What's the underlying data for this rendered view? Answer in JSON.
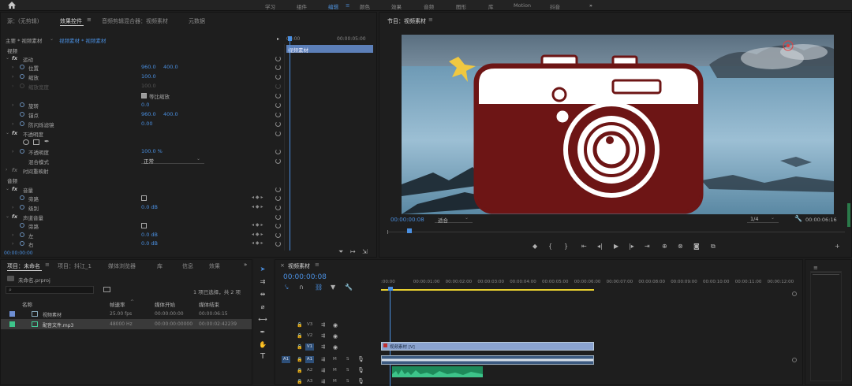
{
  "workspaces": {
    "home_icon": "home-icon",
    "items": [
      "学习",
      "组件",
      "编辑",
      "颜色",
      "效果",
      "音频",
      "图形",
      "库",
      "Motion",
      "抖音"
    ],
    "active": "编辑",
    "more": "»"
  },
  "source_panel": {
    "tabs": [
      "源：(无剪辑)",
      "效果控件",
      "音频剪辑混合器：视频素材",
      "元数据"
    ],
    "active_tab": "效果控件",
    "clip_path": "主要 * 视频素材",
    "clip_active": "视频素材 * 视频素材",
    "mini_timecode_start": "00:00",
    "mini_timecode_end": "00:00:05:00",
    "mini_clip_label": "视频素材",
    "video_header": "视频",
    "motion": {
      "name": "运动",
      "fx": "fx"
    },
    "position": {
      "label": "位置",
      "x": "960.0",
      "y": "400.0"
    },
    "scale": {
      "label": "缩放",
      "value": "100.0"
    },
    "scale_width": {
      "label": "缩放宽度",
      "value": "100.0"
    },
    "uniform_scale": {
      "label": "等比缩放",
      "checked": true
    },
    "rotation": {
      "label": "旋转",
      "value": "0.0"
    },
    "anchor": {
      "label": "锚点",
      "x": "960.0",
      "y": "400.0"
    },
    "flicker": {
      "label": "防闪烁滤镜",
      "value": "0.00"
    },
    "opacity": {
      "name": "不透明度",
      "fx": "fx"
    },
    "opacity_value": {
      "label": "不透明度",
      "value": "100.0 %"
    },
    "blend": {
      "label": "混合模式",
      "value": "正常"
    },
    "time_remap": {
      "name": "时间重映射",
      "fx": "fx"
    },
    "audio_header": "音频",
    "volume": {
      "name": "音量",
      "fx": "fx"
    },
    "bypass1": {
      "label": "旁路"
    },
    "level": {
      "label": "级别",
      "value": "0.0 dB"
    },
    "channel_volume": {
      "name": "声道音量",
      "fx": "fx"
    },
    "bypass2": {
      "label": "旁路"
    },
    "left": {
      "label": "左",
      "value": "0.0 dB"
    },
    "right": {
      "label": "右",
      "value": "0.0 dB"
    },
    "bottom_timecode": "00:00:00:00"
  },
  "program_panel": {
    "title": "节目：视频素材",
    "timecode_current": "00:00:00:08",
    "fit": "适合",
    "resolution": "1/4",
    "timecode_end": "00:00:06:16"
  },
  "project_panel": {
    "tabs": [
      "项目：未命名",
      "项目：抖江_1",
      "媒体浏览器",
      "库",
      "信息",
      "效果"
    ],
    "active_tab": "项目：未命名",
    "more": "»",
    "project_file": "未命名.prproj",
    "selection_info": "1 项已选择，共 2 项",
    "columns": {
      "name": "名称",
      "fps": "帧速率",
      "media_start": "媒体开始",
      "media_end": "媒体结束"
    },
    "items": [
      {
        "name": "视频素材",
        "fps": "25.00 fps",
        "start": "00:00:00:00",
        "end": "00:00:06:15",
        "color": "#6e8fd4"
      },
      {
        "name": "配音文件.mp3",
        "fps": "48000 Hz",
        "start": "00:00:00:00000",
        "end": "00:00:02:42239",
        "color": "#3dc48a"
      }
    ]
  },
  "timeline_panel": {
    "title": "视频素材",
    "timecode": "00:00:00:08",
    "ruler": [
      ":00:00",
      "00:00:01:00",
      "00:00:02:00",
      "00:00:03:00",
      "00:00:04:00",
      "00:00:05:00",
      "00:00:06:00",
      "00:00:07:00",
      "00:00:08:00",
      "00:00:09:00",
      "00:00:10:00",
      "00:00:11:00",
      "00:00:12:00"
    ],
    "video_tracks": [
      "V3",
      "V2",
      "V1"
    ],
    "audio_tracks": [
      "A1",
      "A2",
      "A3"
    ],
    "source_patch": "A1",
    "mute_label": "M",
    "solo_label": "S",
    "v1_clip_label": "视频素材 [V]"
  },
  "colors": {
    "accent_blue": "#4a8fe0",
    "clip_video": "#8aa3d0",
    "clip_audio_green": "#1e8a5a",
    "camera_red": "#6d1515",
    "sparkle_yellow": "#f0c840"
  }
}
